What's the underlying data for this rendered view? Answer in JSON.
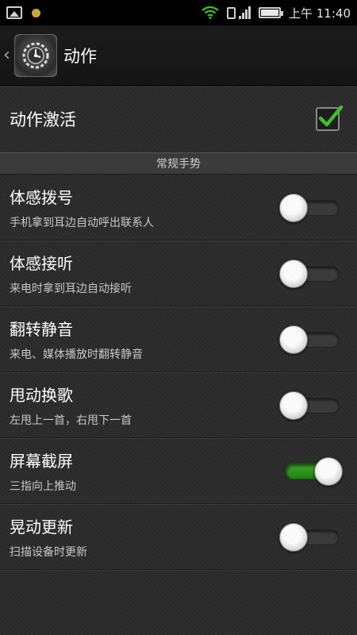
{
  "status_bar": {
    "time": "上午 11:40",
    "icons": [
      "image-icon",
      "notification-dot-icon",
      "wifi-icon",
      "signal-icon",
      "sim-icon",
      "battery-icon"
    ]
  },
  "action_bar": {
    "title": "动作",
    "app_icon": "settings-gear-icon"
  },
  "activation": {
    "label": "动作激活",
    "checked": true
  },
  "section": {
    "title": "常规手势"
  },
  "items": [
    {
      "title": "体感拨号",
      "subtitle": "手机拿到耳边自动呼出联系人",
      "enabled": false
    },
    {
      "title": "体感接听",
      "subtitle": "来电时拿到耳边自动接听",
      "enabled": false
    },
    {
      "title": "翻转静音",
      "subtitle": "来电、媒体播放时翻转静音",
      "enabled": false
    },
    {
      "title": "甩动换歌",
      "subtitle": "左甩上一首，右甩下一首",
      "enabled": false
    },
    {
      "title": "屏幕截屏",
      "subtitle": "三指向上推动",
      "enabled": true
    },
    {
      "title": "晃动更新",
      "subtitle": "扫描设备时更新",
      "enabled": false
    }
  ],
  "colors": {
    "accent_green": "#2e9a1e",
    "check_green": "#3fbf2a",
    "background": "#2b2b2b"
  }
}
